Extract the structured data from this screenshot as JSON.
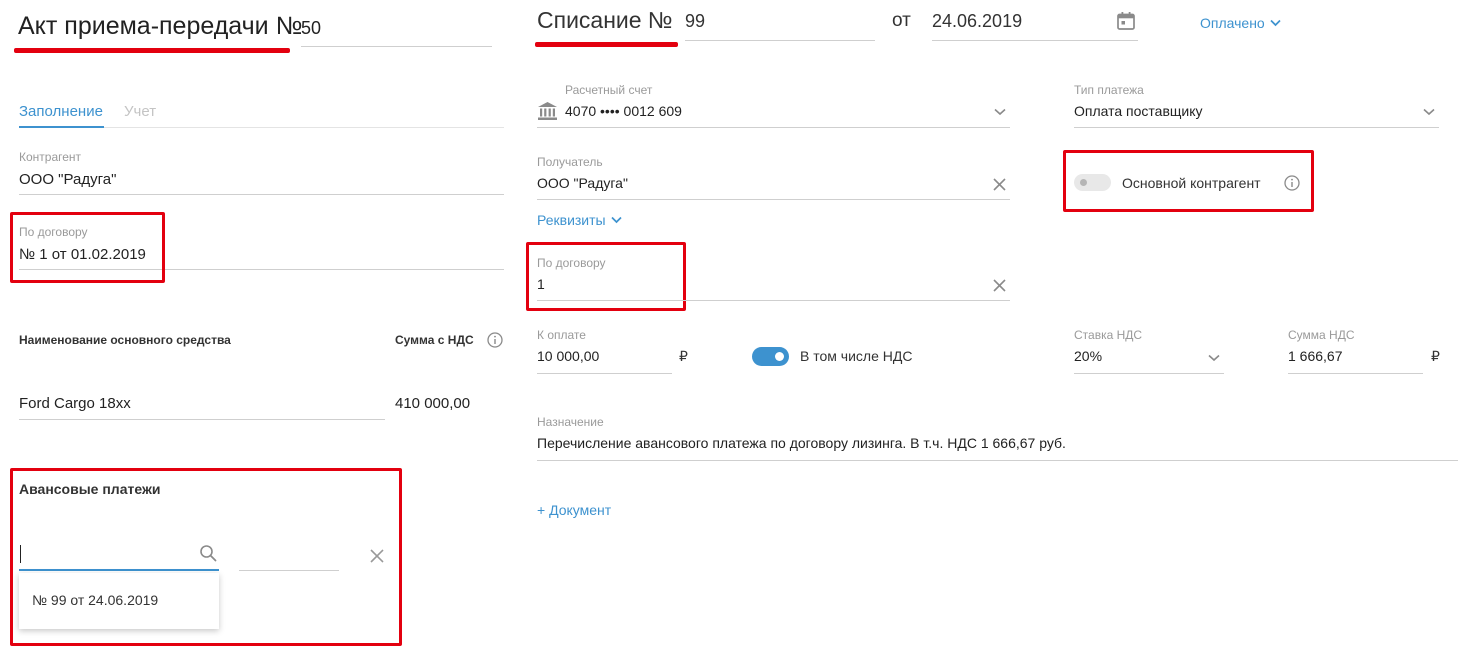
{
  "left": {
    "title": "Акт приема-передачи №",
    "number": "50",
    "tabs": [
      "Заполнение",
      "Учет"
    ],
    "counterparty": {
      "label": "Контрагент",
      "value": "ООО \"Радуга\""
    },
    "contract": {
      "label": "По договору",
      "value": "№ 1 от 01.02.2019"
    },
    "asset_table": {
      "col_name": "Наименование основного средства",
      "col_sum": "Сумма с НДС",
      "rows": [
        {
          "name": "Ford Cargo 18xx",
          "sum": "410 000,00"
        }
      ]
    },
    "advances": {
      "title": "Авансовые платежи",
      "search_value": "",
      "dropdown_item": "№ 99 от 24.06.2019"
    }
  },
  "right": {
    "title": "Списание №",
    "number": "99",
    "date_prefix": "от",
    "date": "24.06.2019",
    "status": "Оплачено",
    "account": {
      "label": "Расчетный счет",
      "value": "4070 •••• 0012 609"
    },
    "payment_type": {
      "label": "Тип платежа",
      "value": "Оплата поставщику"
    },
    "recipient": {
      "label": "Получатель",
      "value": "ООО \"Радуга\""
    },
    "main_counterparty_label": "Основной контрагент",
    "details_link": "Реквизиты",
    "contract": {
      "label": "По договору",
      "value": "1"
    },
    "amount": {
      "label": "К оплате",
      "value": "10 000,00",
      "currency": "₽"
    },
    "vat_included": {
      "label": "В том числе НДС",
      "enabled": true
    },
    "vat_rate": {
      "label": "Ставка НДС",
      "value": "20%"
    },
    "vat_sum": {
      "label": "Сумма НДС",
      "value": "1 666,67",
      "currency": "₽"
    },
    "purpose": {
      "label": "Назначение",
      "value": "Перечисление авансового платежа по договору лизинга. В т.ч. НДС 1 666,67 руб."
    },
    "add_document": "+ Документ"
  },
  "colors": {
    "accent": "#3d92cf",
    "highlight": "#e3000f",
    "toggle_on": "#3d92cf"
  }
}
